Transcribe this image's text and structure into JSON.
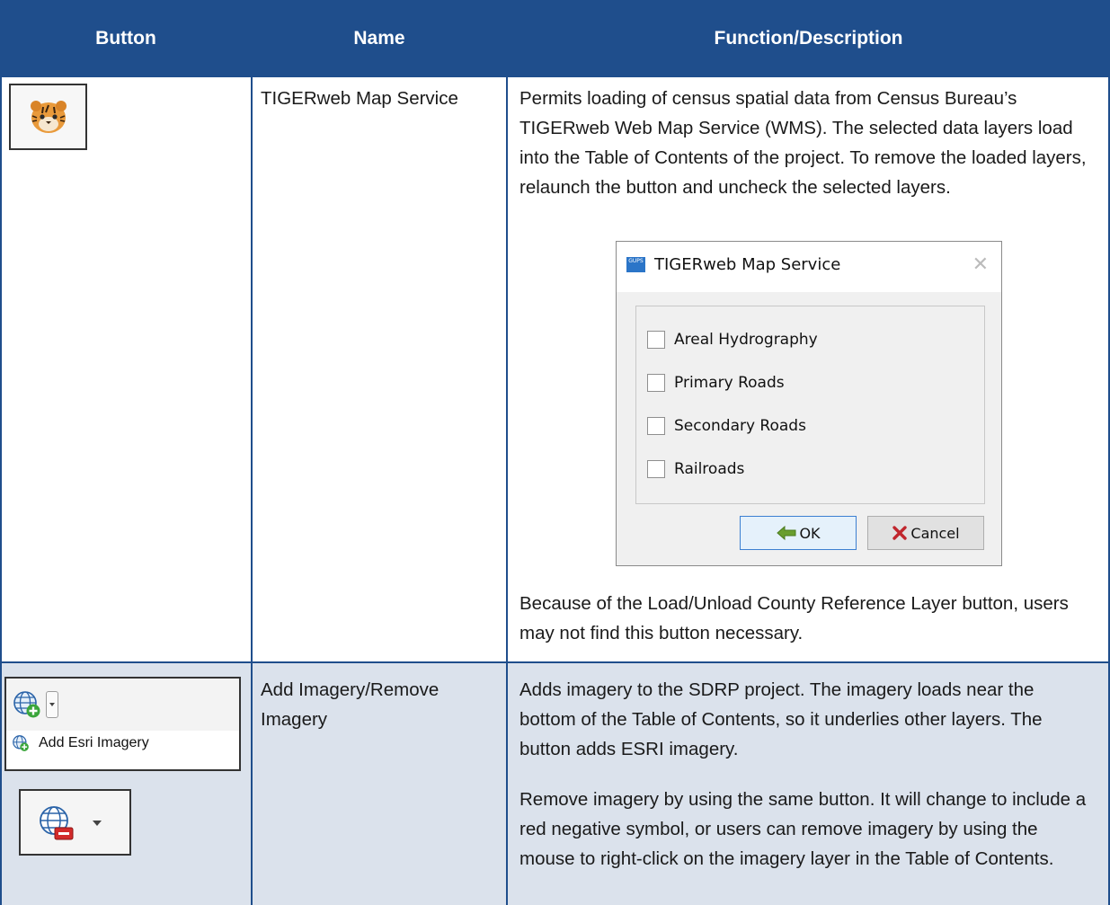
{
  "table": {
    "headers": {
      "button": "Button",
      "name": "Name",
      "function": "Function/Description"
    },
    "colors": {
      "header_bg": "#1f4e8c",
      "header_text": "#ffffff",
      "shaded_row": "#dbe2ec"
    },
    "rows": [
      {
        "button_icon": "tiger-icon",
        "name": "TIGERweb Map Service",
        "desc1": "Permits loading of census spatial data from Census Bureau’s TIGERweb Web Map Service (WMS). The selected data layers load into the Table of Contents of the project. To remove the loaded layers, relaunch the button and uncheck the selected layers.",
        "desc2": "Because of the Load/Unload County Reference Layer button, users may not find this button necessary."
      },
      {
        "button_icon": "globe-add-icon",
        "menu_label": "Add Esri Imagery",
        "remove_icon": "globe-remove-icon",
        "name": "Add Imagery/Remove Imagery",
        "desc1": "Adds imagery to the SDRP project. The imagery loads near the bottom of the Table of Contents, so it underlies other layers. The button adds ESRI imagery.",
        "desc2": "Remove imagery by using the same button. It will change to include a red negative symbol, or users can remove imagery by using the mouse to right-click on the imagery layer in the Table of Contents."
      }
    ]
  },
  "dialog": {
    "app_icon_text": "GUPS",
    "title": "TIGERweb Map Service",
    "close": "✕",
    "layers": [
      "Areal Hydrography",
      "Primary Roads",
      "Secondary Roads",
      "Railroads"
    ],
    "ok_label": "OK",
    "cancel_label": "Cancel"
  }
}
